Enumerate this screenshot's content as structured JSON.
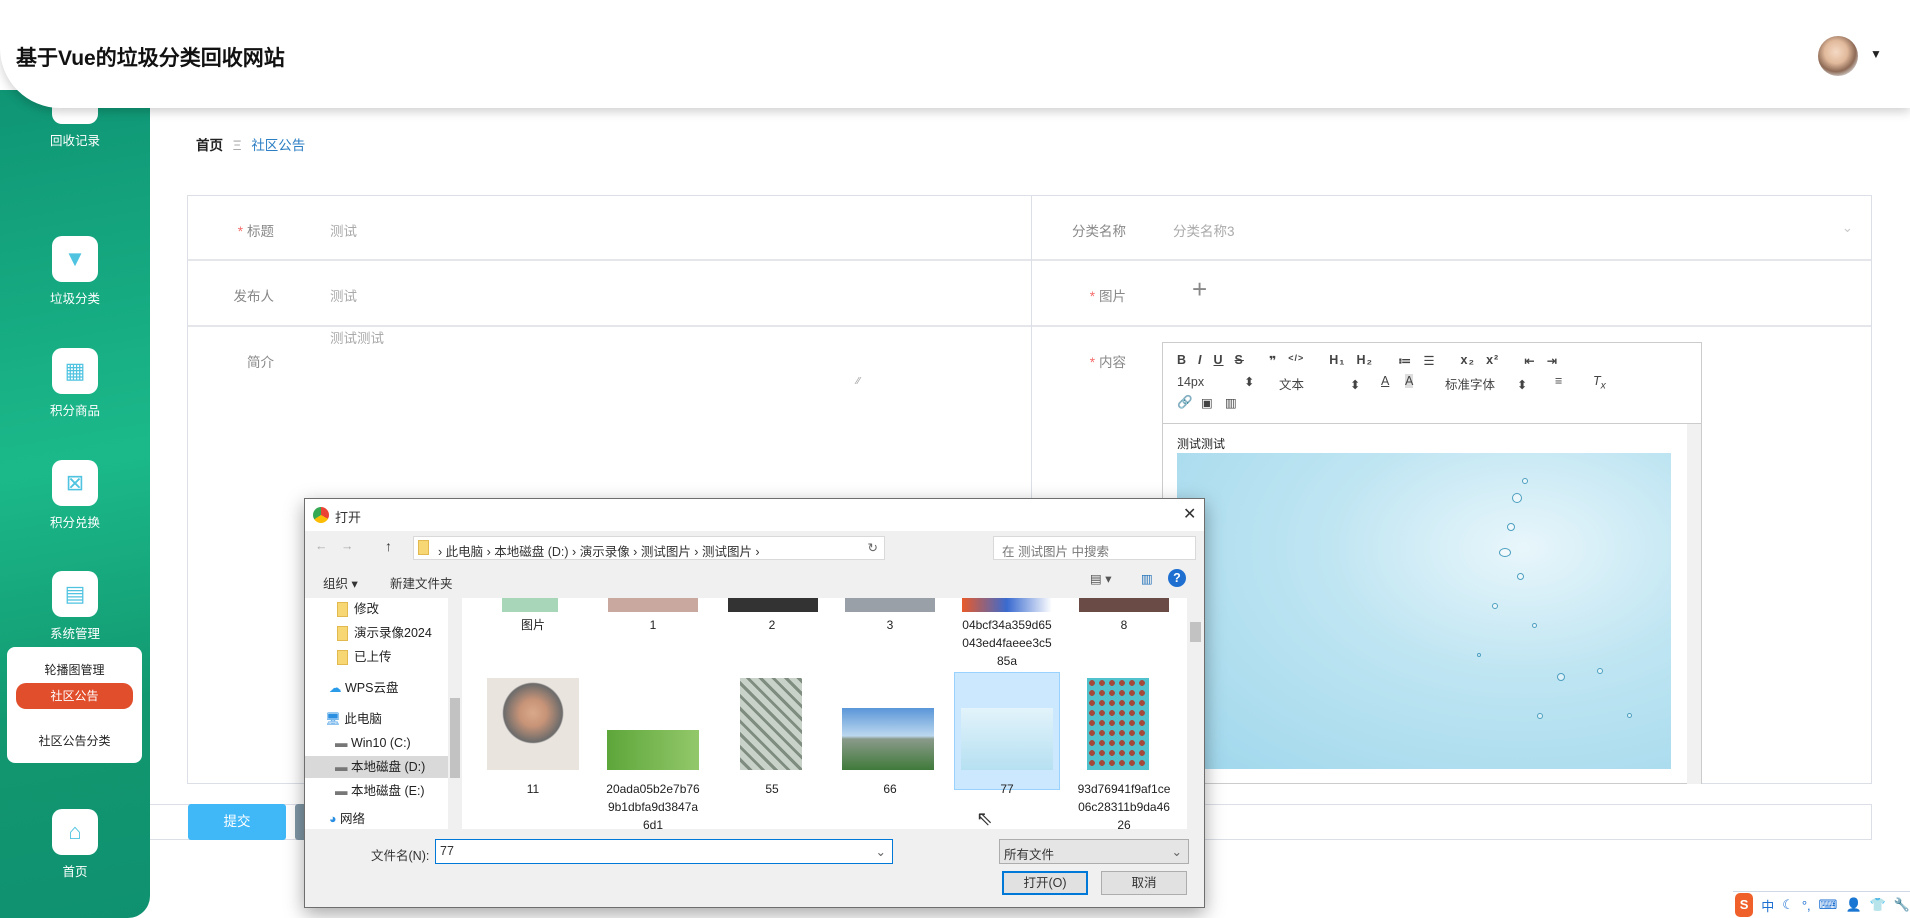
{
  "header": {
    "title": "基于Vue的垃圾分类回收网站"
  },
  "sidebar": {
    "items": [
      {
        "label": "回收记录",
        "icon": "recycle-record-icon"
      },
      {
        "label": "垃圾分类",
        "icon": "brush-icon"
      },
      {
        "label": "积分商品",
        "icon": "grid-icon"
      },
      {
        "label": "积分兑换",
        "icon": "exchange-icon"
      },
      {
        "label": "系统管理",
        "icon": "clipboard-icon"
      },
      {
        "label": "首页",
        "icon": "home-icon"
      }
    ],
    "submenu": [
      {
        "label": "轮播图管理"
      },
      {
        "label": "社区公告",
        "active": true
      },
      {
        "label": "社区公告分类"
      }
    ]
  },
  "breadcrumb": {
    "home": "首页",
    "separator": "Ξ",
    "current": "社区公告"
  },
  "form": {
    "title_label": "标题",
    "title_value": "测试",
    "category_label": "分类名称",
    "category_value": "分类名称3",
    "publisher_label": "发布人",
    "publisher_value": "测试",
    "image_label": "图片",
    "intro_label": "简介",
    "intro_value": "测试测试",
    "content_label": "内容",
    "content_text": "测试测试",
    "required_mark": "*",
    "add_icon": "+"
  },
  "editor": {
    "toolbar_row1": [
      "B",
      "I",
      "U",
      "S",
      "❞",
      "</>",
      "H₁",
      "H₂",
      "≔",
      "☰",
      "x₂",
      "x²",
      "⇤",
      "⇥"
    ],
    "font_size": "14px",
    "header_select": "文本",
    "font_family": "标准字体"
  },
  "buttons": {
    "submit": "提交"
  },
  "dialog": {
    "title": "打开",
    "path": [
      "此电脑",
      "本地磁盘 (D:)",
      "演示录像",
      "测试图片",
      "测试图片"
    ],
    "search_placeholder": "在 测试图片 中搜索",
    "organize": "组织 ▾",
    "new_folder": "新建文件夹",
    "nav": [
      "修改",
      "演示录像2024",
      "已上传",
      "WPS云盘",
      "此电脑",
      "Win10 (C:)",
      "本地磁盘 (D:)",
      "本地磁盘 (E:)",
      "网络"
    ],
    "files_row1": [
      "图片",
      "1",
      "2",
      "3",
      "04bcf34a359d65043ed4faeee3c585a",
      "8"
    ],
    "files_row2": [
      "11",
      "20ada05b2e7b769b1dbfa9d3847a6d1",
      "55",
      "66",
      "77",
      "93d76941f9af1ce06c28311b9da4626"
    ],
    "filename_label": "文件名(N):",
    "filename_value": "77",
    "filetype": "所有文件",
    "open": "打开(O)",
    "cancel": "取消"
  },
  "taskbar": {
    "ime": "中"
  },
  "colors": {
    "sidebar": "#1bb98a",
    "active": "#e04e2c",
    "submit": "#40b8f8",
    "link": "#2d7fc4"
  }
}
